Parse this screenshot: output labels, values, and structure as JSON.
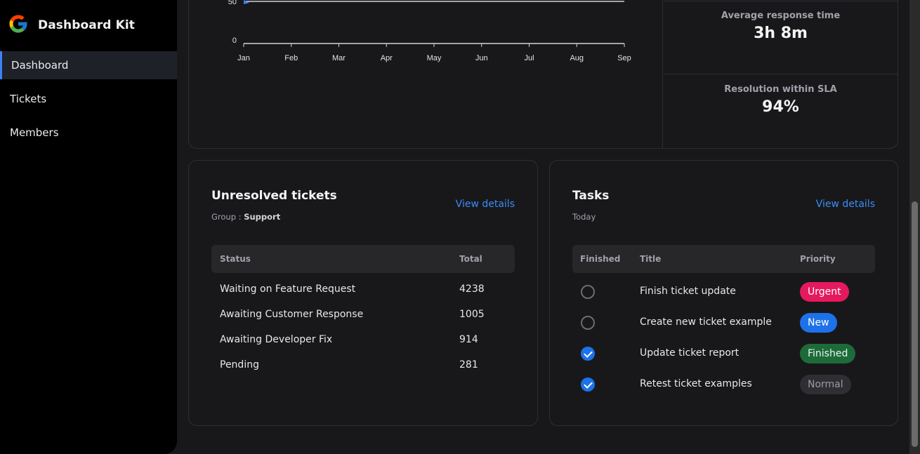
{
  "app": {
    "name": "Dashboard Kit",
    "logo": "google-g-logo"
  },
  "sidebar": {
    "items": [
      {
        "label": "Dashboard",
        "active": true
      },
      {
        "label": "Tickets",
        "active": false
      },
      {
        "label": "Members",
        "active": false
      }
    ]
  },
  "chart_data": {
    "type": "line",
    "categories": [
      "Jan",
      "Feb",
      "Mar",
      "Apr",
      "May",
      "Jun",
      "Jul",
      "Aug",
      "Sep"
    ],
    "y_ticks": [
      "50",
      "0"
    ],
    "series": [
      {
        "values": [
          50,
          50,
          50,
          50,
          50,
          50,
          50,
          50,
          50
        ],
        "color": "#d4d4d8"
      }
    ],
    "ylim": [
      0,
      50
    ],
    "accent": "#3b82f6"
  },
  "stats": [
    {
      "label": "Average response time",
      "value": "3h 8m"
    },
    {
      "label": "Resolution within SLA",
      "value": "94%"
    }
  ],
  "unresolved": {
    "title": "Unresolved tickets",
    "group_prefix": "Group :",
    "group": "Support",
    "link": "View details",
    "headers": {
      "status": "Status",
      "total": "Total"
    },
    "rows": [
      {
        "status": "Waiting on Feature Request",
        "total": "4238"
      },
      {
        "status": "Awaiting Customer Response",
        "total": "1005"
      },
      {
        "status": "Awaiting Developer Fix",
        "total": "914"
      },
      {
        "status": "Pending",
        "total": "281"
      }
    ]
  },
  "tasks": {
    "title": "Tasks",
    "subtitle": "Today",
    "link": "View details",
    "headers": {
      "finished": "Finished",
      "title": "Title",
      "priority": "Priority"
    },
    "rows": [
      {
        "finished": false,
        "title": "Finish ticket update",
        "priority": "Urgent",
        "bg": "#e5195e",
        "fg": "#ffffff"
      },
      {
        "finished": false,
        "title": "Create new ticket example",
        "priority": "New",
        "bg": "#1d72e8",
        "fg": "#ffffff"
      },
      {
        "finished": true,
        "title": "Update ticket report",
        "priority": "Finished",
        "bg": "#1e6b3a",
        "fg": "#e8f5ec"
      },
      {
        "finished": true,
        "title": "Retest ticket examples",
        "priority": "Normal",
        "bg": "#2f2f33",
        "fg": "#9a9aa2"
      }
    ]
  }
}
